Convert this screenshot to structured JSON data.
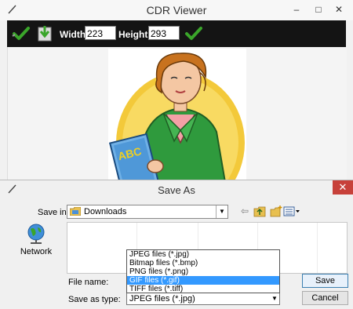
{
  "viewer": {
    "title": "CDR Viewer",
    "toolbar": {
      "width_label": "Width",
      "width_value": "223",
      "height_label": "Height",
      "height_value": "293"
    },
    "image_card_text": "ABC"
  },
  "dialog": {
    "title": "Save As",
    "save_in_label": "Save in:",
    "save_in_value": "Downloads",
    "places": [
      {
        "label": "Network"
      }
    ],
    "file_name_label": "File name:",
    "save_as_type_label": "Save as type:",
    "save_as_type_value": "JPEG files (*.jpg)",
    "type_options": [
      {
        "label": "JPEG files (*.jpg)",
        "selected": false
      },
      {
        "label": "Bitmap files (*.bmp)",
        "selected": false
      },
      {
        "label": "PNG files (*.png)",
        "selected": false
      },
      {
        "label": "GIF files (*.gif)",
        "selected": true
      },
      {
        "label": "TIFF files (*.tiff)",
        "selected": false
      }
    ],
    "save_button": "Save",
    "cancel_button": "Cancel",
    "close_glyph": "✕"
  },
  "window_controls": {
    "minimize": "–",
    "maximize": "□",
    "close": "✕"
  },
  "colors": {
    "toolbar_bg": "#141414",
    "accent_check": "#3aa52a",
    "selection": "#3399ff",
    "dialog_close": "#c7413a"
  },
  "icons": [
    "brush-icon",
    "check-icon",
    "save-down-icon",
    "folder-icon",
    "back-arrow-icon",
    "up-folder-icon",
    "new-folder-icon",
    "views-icon",
    "network-icon"
  ]
}
